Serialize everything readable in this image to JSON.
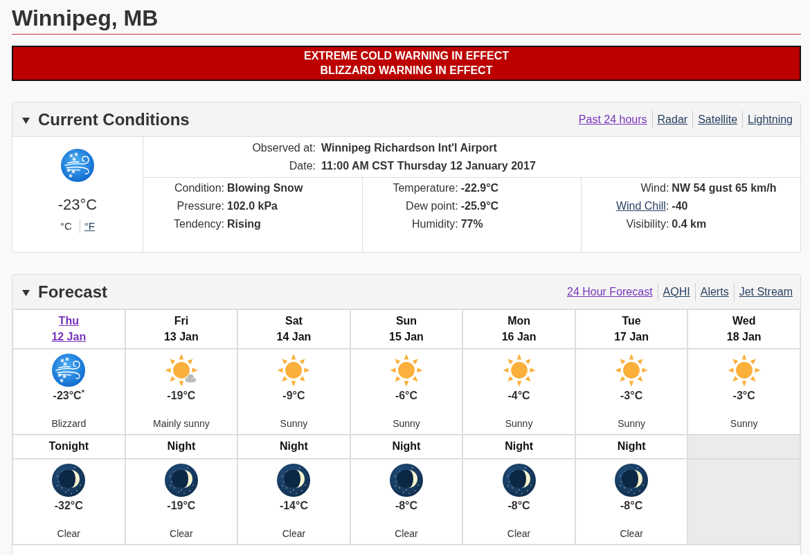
{
  "location": {
    "title": "Winnipeg, MB"
  },
  "warnings": [
    "EXTREME COLD WARNING IN EFFECT",
    "BLIZZARD WARNING IN EFFECT"
  ],
  "current_conditions": {
    "title": "Current Conditions",
    "expanded": true,
    "links": [
      {
        "label": "Past 24 hours",
        "visited": true
      },
      {
        "label": "Radar",
        "visited": false
      },
      {
        "label": "Satellite",
        "visited": false
      },
      {
        "label": "Lightning",
        "visited": false
      }
    ],
    "temperature": "-23°C",
    "units": [
      {
        "label": "°C",
        "selected": true
      },
      {
        "label": "°F",
        "selected": false
      }
    ],
    "observed": [
      {
        "label": "Observed at:",
        "value": "Winnipeg Richardson Int'l Airport"
      },
      {
        "label": "Date:",
        "value": "11:00 AM CST Thursday 12 January 2017"
      }
    ],
    "details": {
      "columns": [
        {
          "rows": [
            {
              "label": "Condition:",
              "value": "Blowing Snow",
              "link": false
            },
            {
              "label": "Pressure:",
              "value": "102.0 kPa",
              "link": false
            },
            {
              "label": "Tendency:",
              "value": "Rising",
              "link": false
            }
          ]
        },
        {
          "rows": [
            {
              "label": "Temperature:",
              "value": "-22.9°C",
              "link": false
            },
            {
              "label": "Dew point:",
              "value": "-25.9°C",
              "link": false
            },
            {
              "label": "Humidity:",
              "value": "77%",
              "link": false
            }
          ]
        },
        {
          "rows": [
            {
              "label": "Wind:",
              "value": "NW 54 gust 65 km/h",
              "link": false
            },
            {
              "label": "Wind Chill",
              "suffix": ":",
              "value": "-40",
              "link": true
            },
            {
              "label": "Visibility:",
              "value": "0.4 km",
              "link": false
            }
          ]
        }
      ]
    }
  },
  "forecast": {
    "title": "Forecast",
    "expanded": true,
    "links": [
      {
        "label": "24 Hour Forecast",
        "visited": true
      },
      {
        "label": "AQHI",
        "visited": false
      },
      {
        "label": "Alerts",
        "visited": false
      },
      {
        "label": "Jet Stream",
        "visited": false
      }
    ],
    "days": [
      {
        "day": "Thu",
        "date": "12 Jan",
        "link": true,
        "kind": "snow",
        "temperature": "-23°C$^{*}$",
        "summary": "Blizzard"
      },
      {
        "day": "Fri",
        "date": "13 Jan",
        "link": false,
        "kind": "suncloud",
        "temperature": "-19°C",
        "summary": "Mainly sunny"
      },
      {
        "day": "Sat",
        "date": "14 Jan",
        "link": false,
        "kind": "sun",
        "temperature": "-9°C",
        "summary": "Sunny"
      },
      {
        "day": "Sun",
        "date": "15 Jan",
        "link": false,
        "kind": "sun",
        "temperature": "-6°C",
        "summary": "Sunny"
      },
      {
        "day": "Mon",
        "date": "16 Jan",
        "link": false,
        "kind": "sun",
        "temperature": "-4°C",
        "summary": "Sunny"
      },
      {
        "day": "Tue",
        "date": "17 Jan",
        "link": false,
        "kind": "sun",
        "temperature": "-3°C",
        "summary": "Sunny"
      },
      {
        "day": "Wed",
        "date": "18 Jan",
        "link": false,
        "kind": "sun",
        "temperature": "-3°C",
        "summary": "Sunny"
      }
    ],
    "nights": [
      {
        "label": "Tonight",
        "kind": "moon",
        "temperature": "-32°C",
        "summary": "Clear"
      },
      {
        "label": "Night",
        "kind": "moon",
        "temperature": "-19°C",
        "summary": "Clear"
      },
      {
        "label": "Night",
        "kind": "moon",
        "temperature": "-14°C",
        "summary": "Clear"
      },
      {
        "label": "Night",
        "kind": "moon",
        "temperature": "-8°C",
        "summary": "Clear"
      },
      {
        "label": "Night",
        "kind": "moon",
        "temperature": "-8°C",
        "summary": "Clear"
      },
      {
        "label": "Night",
        "kind": "moon",
        "temperature": "-8°C",
        "summary": "Clear"
      }
    ]
  }
}
